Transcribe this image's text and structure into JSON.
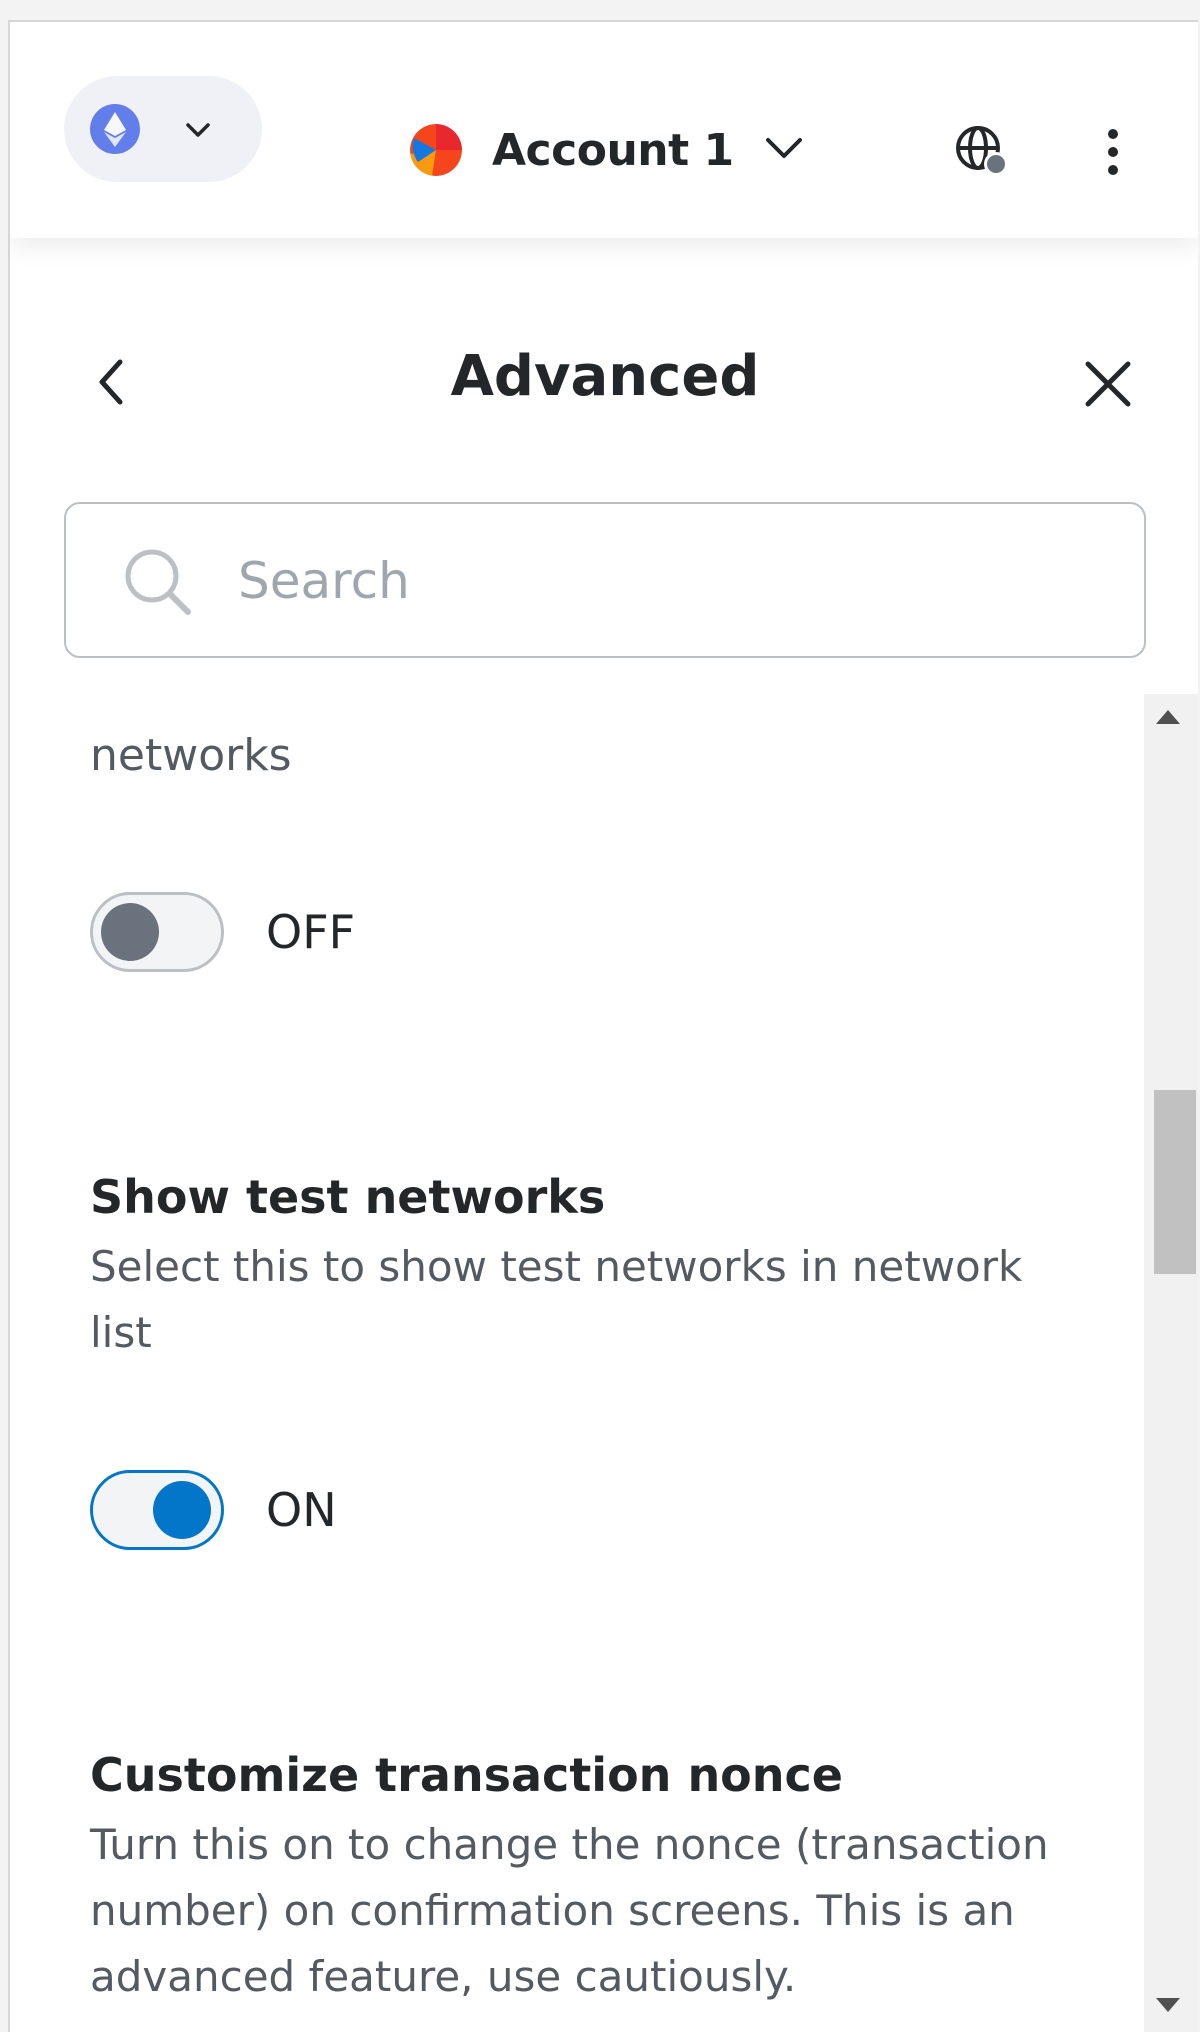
{
  "header": {
    "network_icon": "ethereum-icon",
    "account_name": "Account 1",
    "account_avatar_icon": "account-avatar-icon",
    "connected_sites_icon": "globe-icon",
    "menu_icon": "kebab-menu-icon"
  },
  "page": {
    "title": "Advanced",
    "back_icon": "chevron-left-icon",
    "close_icon": "close-icon"
  },
  "search": {
    "placeholder": "Search",
    "value": ""
  },
  "settings": {
    "fragment_text": "networks",
    "first_toggle": {
      "state_label": "OFF",
      "checked": false
    },
    "show_test_networks": {
      "title": "Show test networks",
      "description": "Select this to show test networks in network list",
      "state_label": "ON",
      "checked": true
    },
    "customize_nonce": {
      "title": "Customize transaction nonce",
      "description": "Turn this on to change the nonce (transaction number) on confirmation screens. This is an advanced feature, use cautiously."
    }
  },
  "colors": {
    "accent": "#0376c9",
    "ethereum": "#627eea",
    "text_primary": "#24272a",
    "text_secondary": "#535a61"
  }
}
